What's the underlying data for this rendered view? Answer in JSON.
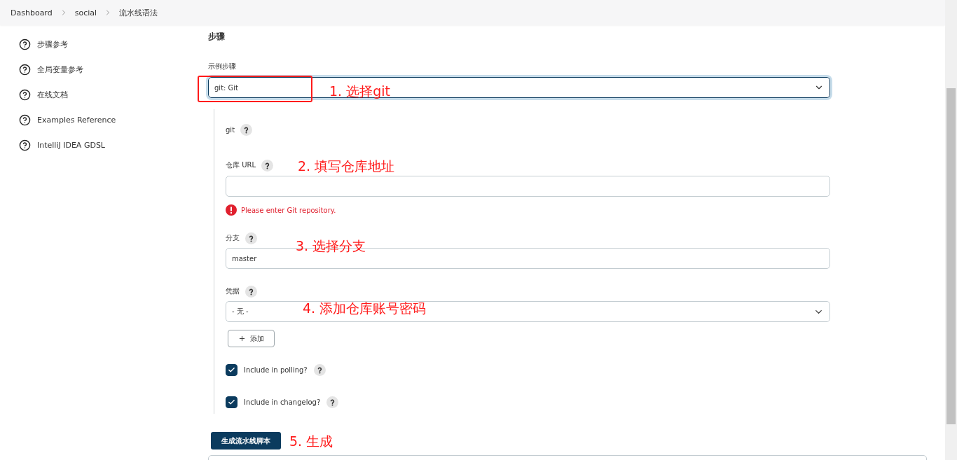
{
  "breadcrumb": [
    {
      "label": "Dashboard"
    },
    {
      "label": "social"
    },
    {
      "label": "流水线语法"
    }
  ],
  "sidebar": {
    "items": [
      {
        "label": "步骤参考"
      },
      {
        "label": "全局变量参考"
      },
      {
        "label": "在线文档"
      },
      {
        "label": "Examples Reference"
      },
      {
        "label": "IntelliJ IDEA GDSL"
      }
    ]
  },
  "section_title": "步骤",
  "sample_step": {
    "label": "示例步骤",
    "value": "git: Git"
  },
  "git_step": {
    "label": "git",
    "repository": {
      "label": "仓库 URL",
      "error": "Please enter Git repository."
    },
    "branch": {
      "label": "分支",
      "value": "master"
    },
    "credentials": {
      "label": "凭据",
      "value": "- 无 -",
      "add_button": "添加"
    },
    "checkboxes": [
      {
        "label": "Include in polling?",
        "checked": true
      },
      {
        "label": "Include in changelog?",
        "checked": true
      }
    ]
  },
  "generate_button": "生成流水线脚本",
  "annotations": [
    {
      "text": "1. 选择git"
    },
    {
      "text": "2. 填写仓库地址"
    },
    {
      "text": "3. 选择分支"
    },
    {
      "text": "4. 添加仓库账号密码"
    },
    {
      "text": "5. 生成"
    }
  ]
}
